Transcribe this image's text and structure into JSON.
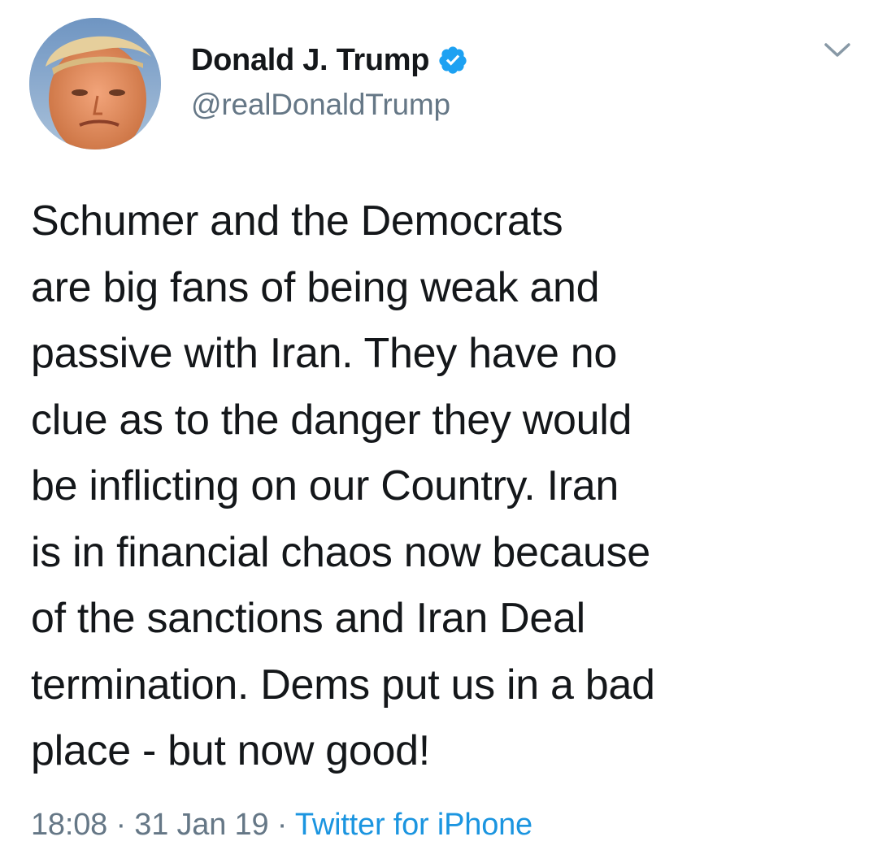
{
  "author": {
    "display_name": "Donald J. Trump",
    "handle": "@realDonaldTrump",
    "verified": true
  },
  "icons": {
    "avatar": "profile-photo",
    "verified": "verified-badge-icon",
    "caret": "chevron-down-icon"
  },
  "colors": {
    "verified_blue": "#1da1f2",
    "link_blue": "#1b95e0",
    "text_gray": "#657786",
    "text_black": "#14171a"
  },
  "tweet": {
    "lines": [
      "Schumer and the Democrats",
      "are big fans of being weak and",
      "passive with Iran. They have no",
      "clue as to the danger they would",
      "be inflicting on our Country. Iran",
      "is in financial chaos now because",
      "of the sanctions and Iran Deal",
      "termination. Dems put us in a bad",
      "place - but now good!"
    ]
  },
  "meta": {
    "time": "18:08",
    "separator": "·",
    "date": "31 Jan 19",
    "source": "Twitter for iPhone"
  }
}
